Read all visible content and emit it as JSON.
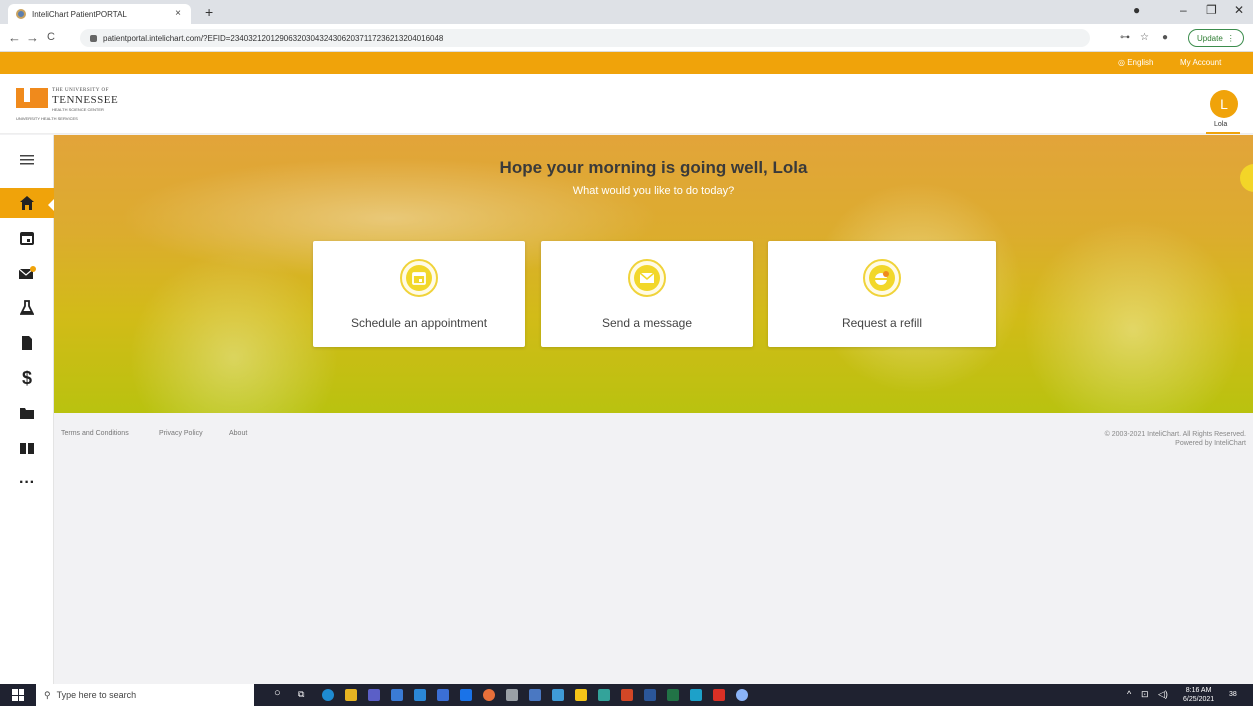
{
  "browser": {
    "tab_title": "InteliChart PatientPORTAL",
    "tab_close": "×",
    "new_tab": "+",
    "url": "patientportal.intelichart.com/?EFID=234032120129063203043243062037117236213204016048",
    "update_label": "Update",
    "back": "←",
    "forward": "→",
    "reload": "C"
  },
  "topbar": {
    "language": "English",
    "my_account": "My Account"
  },
  "logo": {
    "line1": "THE UNIVERSITY OF",
    "line2": "TENNESSEE",
    "line3": "HEALTH SCIENCE CENTER",
    "line4": "UNIVERSITY HEALTH SERVICES"
  },
  "user": {
    "initial": "L",
    "name": "Lola"
  },
  "hero": {
    "greeting": "Hope your morning is going well, Lola",
    "subtitle": "What would you like to do today?"
  },
  "cards": [
    {
      "label": "Schedule an appointment",
      "icon": "calendar-icon"
    },
    {
      "label": "Send a message",
      "icon": "envelope-icon"
    },
    {
      "label": "Request a refill",
      "icon": "pill-icon"
    }
  ],
  "sidebar": {
    "items": [
      {
        "name": "menu",
        "icon": "hamburger-icon"
      },
      {
        "name": "home",
        "icon": "home-icon",
        "active": true
      },
      {
        "name": "appointments",
        "icon": "calendar-icon"
      },
      {
        "name": "messages",
        "icon": "envelope-icon"
      },
      {
        "name": "lab-results",
        "icon": "flask-icon"
      },
      {
        "name": "documents",
        "icon": "document-icon"
      },
      {
        "name": "billing",
        "icon": "dollar-icon",
        "glyph": "$"
      },
      {
        "name": "files",
        "icon": "folder-icon"
      },
      {
        "name": "education",
        "icon": "book-icon"
      },
      {
        "name": "more",
        "icon": "more-icon",
        "glyph": "···"
      }
    ]
  },
  "footer": {
    "terms": "Terms and Conditions",
    "privacy": "Privacy Policy",
    "about": "About",
    "copyright": "© 2003-2021 InteliChart. All Rights Reserved.",
    "powered": "Powered by InteliChart"
  },
  "taskbar": {
    "search_placeholder": "Type here to search",
    "time": "8:16 AM",
    "date": "6/25/2021",
    "notifications": "38"
  },
  "colors": {
    "accent": "#f0a30a",
    "card_icon": "#f2d72a"
  }
}
